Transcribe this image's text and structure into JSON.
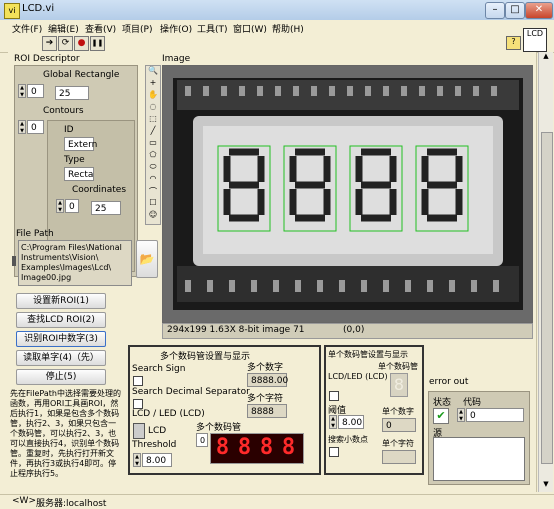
{
  "window": {
    "title": "LCD.vi",
    "icon_text": "vi"
  },
  "menu": [
    "文件(F)",
    "编辑(E)",
    "查看(V)",
    "项目(P)",
    "操作(O)",
    "工具(T)",
    "窗口(W)",
    "帮助(H)"
  ],
  "toolbar": {
    "run": "➔",
    "run_continuous": "⟳",
    "abort": "●",
    "pause": "❚❚",
    "help": "?",
    "lv_icon": "LCD"
  },
  "roi": {
    "title": "ROI Descriptor",
    "global_rect_label": "Global Rectangle",
    "global_index": "0",
    "global_value": "25",
    "contours_label": "Contours",
    "contours_index": "0",
    "id_label": "ID",
    "id_value": "Extern",
    "type_label": "Type",
    "type_value": "Recta",
    "coords_label": "Coordinates",
    "coords_index": "0",
    "coords_value": "25"
  },
  "filepath": {
    "label": "File Path",
    "value": "C:\\Program Files\\National Instruments\\Vision\\Examples\\Images\\Lcd\\Image00.jpg",
    "lines": [
      "C:\\Program Files\\National",
      "Instruments\\Vision\\",
      "Examples\\Images\\Lcd\\",
      "Image00.jpg"
    ]
  },
  "buttons": {
    "set_roi": "设置新ROI(1)",
    "find_lcd_roi": "查找LCD ROI(2)",
    "recognize_roi": "识别ROI中数字(3)",
    "read_single": "读取单字(4)（先）",
    "stop": "停止(5)"
  },
  "instructions": "先在FilePath中选择需要处理的函数，再用ORI工具画ROI，然后执行1，如果是包含多个数码管，执行2、3，如果只包含一个数码管，可以执行2、3，也可以直接执行4，识别单个数码管。重复时，先执行打开新文件，再执行3或执行4即可。停止程序执行5。",
  "instruction_lines": [
    "先在FilePath中选择需要处理的",
    "函数，再用ORI工具画ROI，然",
    "后执行1，如果是包含多个数码",
    "管，执行2、3，如果只包含一",
    "个数码管，可以执行2、3，也",
    "可以直接执行4，识别单个数码",
    "管。重复时，先执行打开新文",
    "件，再执行3或执行4即可。停",
    "止程序执行5。"
  ],
  "image": {
    "label": "Image",
    "info": "294x199 1.63X 8-bit image 71",
    "coords": "(0,0)",
    "lcd_digits": [
      "8",
      "8",
      "8",
      "8"
    ]
  },
  "tools": [
    "🔍",
    "+",
    "✋",
    "◌",
    "⬚",
    "╱",
    "▭",
    "⬠",
    "⬭",
    "◠",
    "⌒",
    "☐",
    "☺"
  ],
  "multi": {
    "title": "多个数码管设置与显示",
    "search_sign": "Search Sign",
    "search_decimal": "Search Decimal Separator",
    "lcd_led_label": "LCD / LED (LCD)",
    "lcd_label": "LCD",
    "threshold_label": "Threshold",
    "threshold_value": "8.00",
    "num_label": "多个数字",
    "num_value": "8888.00",
    "chars_label": "多个字符",
    "chars_value": "8888",
    "digits_label": "多个数码管",
    "digits_index": "0",
    "display": [
      "8",
      "8",
      "8",
      "8"
    ]
  },
  "single": {
    "title": "单个数码管设置与显示",
    "lcd_led_label": "LCD/LED (LCD)",
    "single_digit_label": "单个数码管",
    "threshold_label": "阈值",
    "threshold_value": "8.00",
    "decimal_label": "搜索小数点",
    "num_label": "单个数字",
    "num_value": "0",
    "char_label": "单个字符"
  },
  "error": {
    "title": "error out",
    "status_label": "状态",
    "code_label": "代码",
    "code_value": "0",
    "source_label": "源"
  },
  "status": {
    "context": "<W>",
    "server": "服务器:localhost"
  },
  "colors": {
    "panel": "#f3eed5",
    "led_on": "#ff2a2a",
    "led_bg": "#2a0000",
    "roi_green": "#22c022"
  }
}
